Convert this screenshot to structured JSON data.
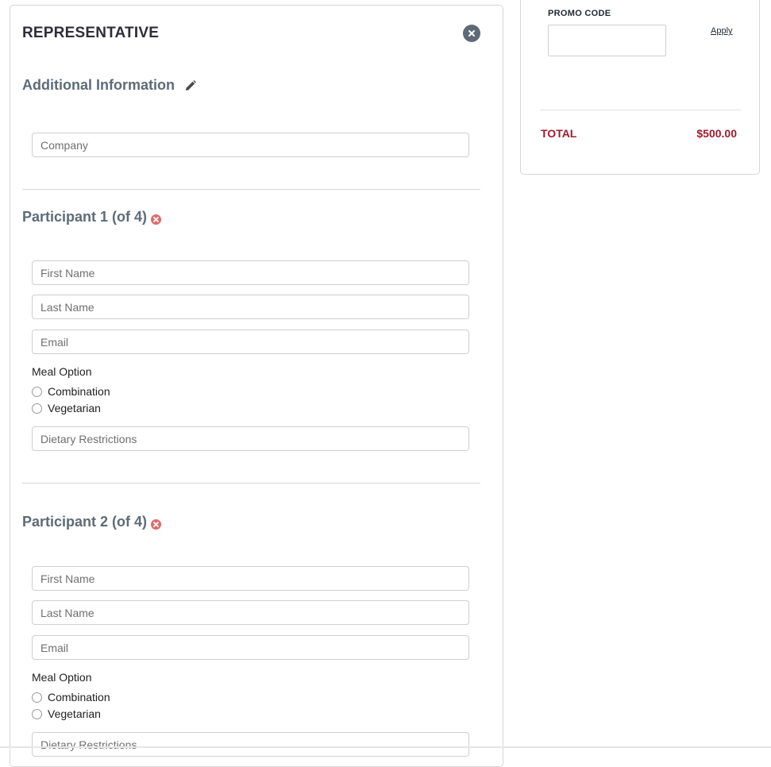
{
  "representative": {
    "title": "REPRESENTATIVE"
  },
  "additional_info": {
    "heading": "Additional Information",
    "company_placeholder": "Company"
  },
  "participants": [
    {
      "heading": "Participant 1 (of 4)",
      "first_name_placeholder": "First Name",
      "last_name_placeholder": "Last Name",
      "email_placeholder": "Email",
      "meal_label": "Meal Option",
      "meal_options": [
        "Combination",
        "Vegetarian"
      ],
      "dietary_placeholder": "Dietary Restrictions"
    },
    {
      "heading": "Participant 2 (of 4)",
      "first_name_placeholder": "First Name",
      "last_name_placeholder": "Last Name",
      "email_placeholder": "Email",
      "meal_label": "Meal Option",
      "meal_options": [
        "Combination",
        "Vegetarian"
      ],
      "dietary_placeholder": "Dietary Restrictions"
    }
  ],
  "summary": {
    "promo_label": "PROMO CODE",
    "promo_value": "",
    "apply_label": "Apply",
    "total_label": "TOTAL",
    "total_value": "$500.00"
  },
  "colors": {
    "heading": "#5d6b78",
    "total": "#a01b2d",
    "remove_icon": "#e06b6b",
    "close_button": "#5e6a75"
  },
  "icons": {
    "close": "close-icon",
    "edit": "pencil-icon",
    "remove": "remove-circle-icon"
  }
}
